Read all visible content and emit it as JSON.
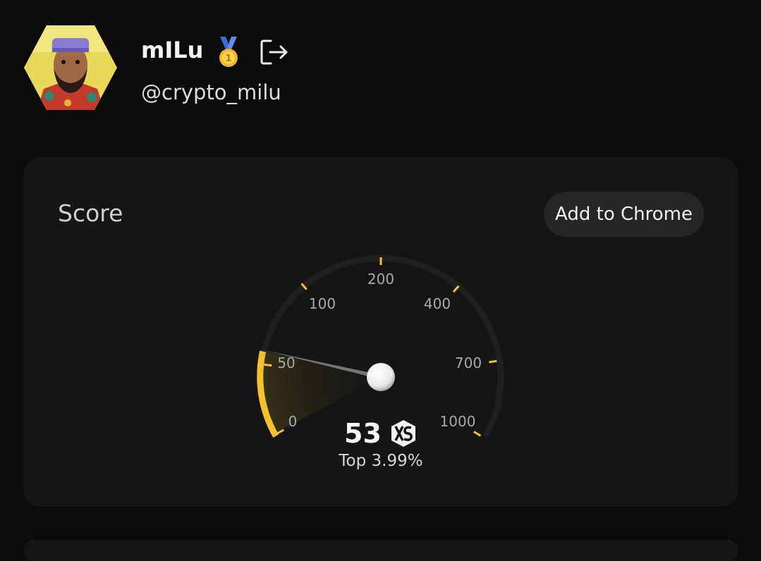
{
  "profile": {
    "name": "mILu",
    "handle": "@crypto_milu",
    "badge_icon": "gold-medal-icon",
    "logout_icon": "logout-icon"
  },
  "score_card": {
    "title": "Score",
    "add_to_chrome_label": "Add to Chrome",
    "score_value": "53",
    "token_icon": "xs-logo-icon",
    "percentile_text": "Top 3.99%",
    "gauge": {
      "ticks": [
        "0",
        "50",
        "100",
        "200",
        "400",
        "700",
        "1000"
      ],
      "value": 53,
      "accent_color": "#f5c12e"
    }
  },
  "colors": {
    "background": "#0b0b0b",
    "card": "#151515",
    "accent": "#f5c12e"
  }
}
